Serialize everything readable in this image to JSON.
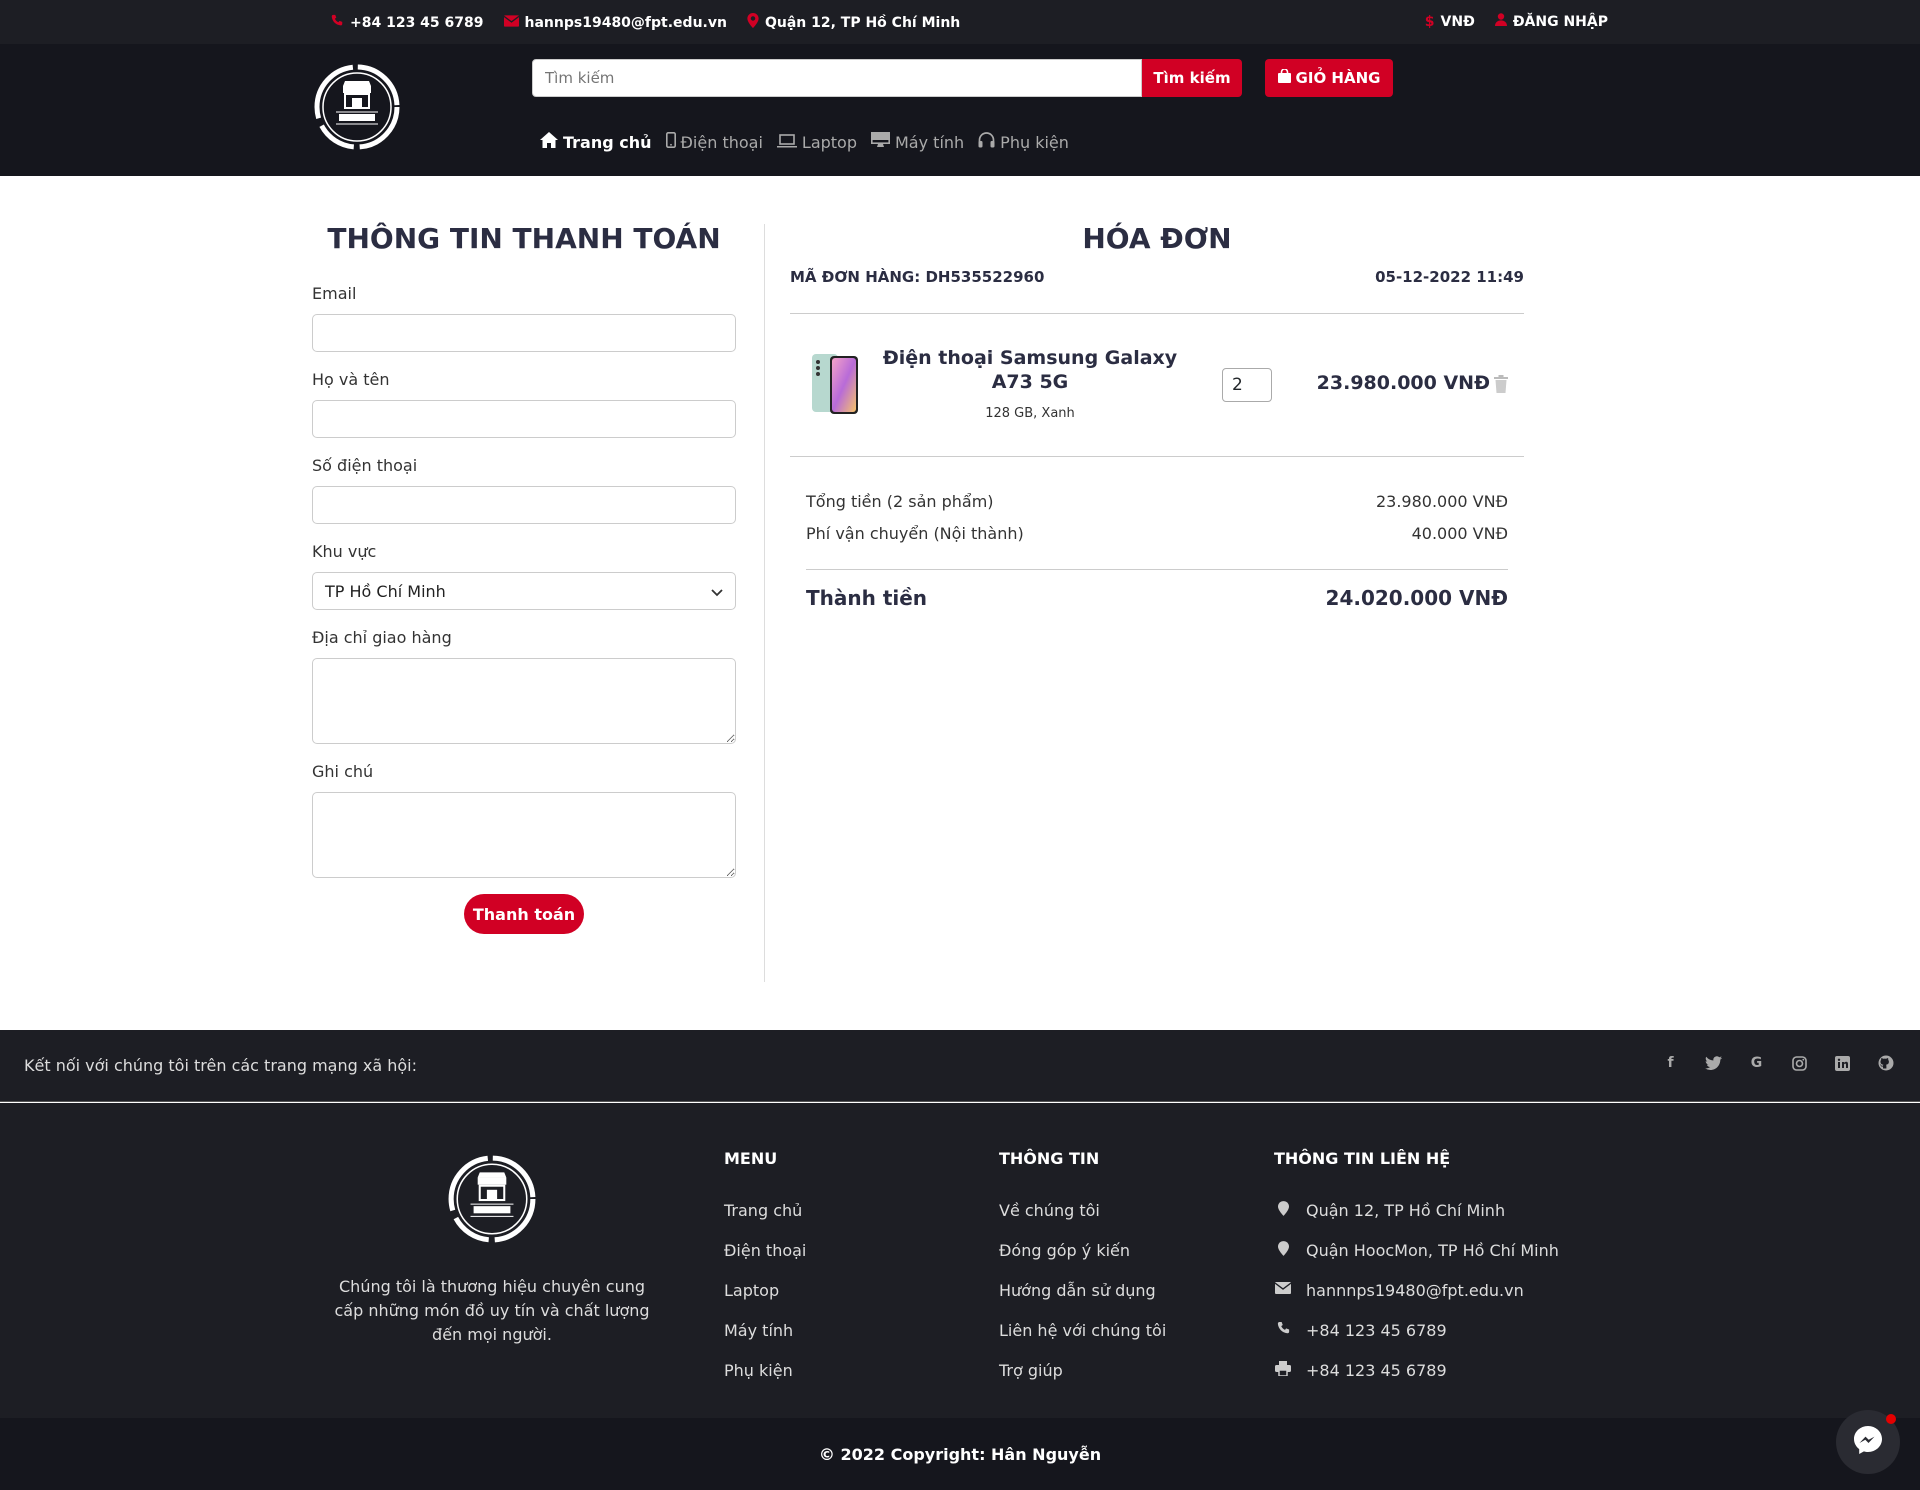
{
  "topbar": {
    "phone": "+84 123 45 6789",
    "email": "hannps19480@fpt.edu.vn",
    "address": "Quận 12, TP Hồ Chí Minh",
    "currency": "VNĐ",
    "login": "ĐĂNG NHẬP"
  },
  "header": {
    "search_placeholder": "Tìm kiếm",
    "search_button": "Tìm kiếm",
    "cart_button": "GIỎ HÀNG"
  },
  "nav": {
    "items": [
      {
        "label": "Trang chủ",
        "icon": "home-icon"
      },
      {
        "label": "Điện thoại",
        "icon": "phone-icon"
      },
      {
        "label": "Laptop",
        "icon": "laptop-icon"
      },
      {
        "label": "Máy tính",
        "icon": "desktop-icon"
      },
      {
        "label": "Phụ kiện",
        "icon": "headphones-icon"
      }
    ]
  },
  "billing": {
    "title": "THÔNG TIN THANH TOÁN",
    "email_label": "Email",
    "name_label": "Họ và tên",
    "phone_label": "Số điện thoại",
    "region_label": "Khu vực",
    "region_value": "TP Hồ Chí Minh",
    "address_label": "Địa chỉ giao hàng",
    "note_label": "Ghi chú",
    "submit": "Thanh toán"
  },
  "invoice": {
    "title": "HÓA ĐƠN",
    "order_code": "MÃ ĐƠN HÀNG: DH535522960",
    "date": "05-12-2022 11:49",
    "product": {
      "name": "Điện thoại Samsung Galaxy A73 5G",
      "variant": "128 GB, Xanh",
      "quantity": "2",
      "price": "23.980.000 VNĐ"
    },
    "subtotal_label": "Tổng tiền (2 sản phẩm)",
    "subtotal_value": "23.980.000 VNĐ",
    "shipping_label": "Phí vận chuyển (Nội thành)",
    "shipping_value": "40.000 VNĐ",
    "total_label": "Thành tiền",
    "total_value": "24.020.000 VNĐ"
  },
  "social": {
    "text": "Kết nối với chúng tôi trên các trang mạng xã hội:",
    "icons": [
      "facebook-icon",
      "twitter-icon",
      "google-icon",
      "instagram-icon",
      "linkedin-icon",
      "github-icon"
    ]
  },
  "footer": {
    "description": "Chúng tôi là thương hiệu chuyên cung cấp những món đồ uy tín và chất lượng đến mọi người.",
    "menu_title": "MENU",
    "menu_items": [
      "Trang chủ",
      "Điện thoại",
      "Laptop",
      "Máy tính",
      "Phụ kiện"
    ],
    "info_title": "THÔNG TIN",
    "info_items": [
      "Về chúng tôi",
      "Đóng góp ý kiến",
      "Hướng dẫn sử dụng",
      "Liên hệ với chúng tôi",
      "Trợ giúp"
    ],
    "contact_title": "THÔNG TIN LIÊN HỆ",
    "contact_items": [
      {
        "icon": "map-pin-icon",
        "text": "Quận 12, TP Hồ Chí Minh"
      },
      {
        "icon": "map-pin-icon",
        "text": "Quận HoocMon, TP Hồ Chí Minh"
      },
      {
        "icon": "envelope-icon",
        "text": "hannnps19480@fpt.edu.vn"
      },
      {
        "icon": "phone-icon",
        "text": "+84 123 45 6789"
      },
      {
        "icon": "printer-icon",
        "text": "+84 123 45 6789"
      }
    ],
    "copyright": "© 2022 Copyright: Hân Nguyễn"
  },
  "colors": {
    "accent": "#d10024",
    "dark": "#1d1e24",
    "darker": "#15161d"
  }
}
